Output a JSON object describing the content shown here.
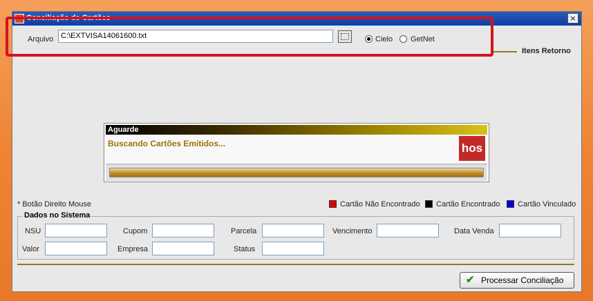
{
  "window": {
    "title": "Conciliação de Cartões",
    "close_label": "×"
  },
  "file": {
    "label": "Arquivo",
    "value": "C:\\EXTVISA14061600.txt",
    "options": [
      "Cielo",
      "GetNet"
    ],
    "selected": "Cielo"
  },
  "section_itens_retorno": "Itens Retorno",
  "progress": {
    "title": "Aguarde",
    "message": "Buscando Cartões Emitidos...",
    "logo_text": "hos",
    "fraction": 1.0
  },
  "hint": "* Botão Direito Mouse",
  "legend": [
    {
      "label": "Cartão Não Encontrado",
      "color": "#e00000"
    },
    {
      "label": "Cartão Encontrado",
      "color": "#000000"
    },
    {
      "label": "Cartão Vinculado",
      "color": "#0000e0"
    }
  ],
  "dados": {
    "title": "Dados no Sistema",
    "fields": {
      "nsu": {
        "label": "NSU",
        "value": ""
      },
      "cupom": {
        "label": "Cupom",
        "value": ""
      },
      "parcela": {
        "label": "Parcela",
        "value": ""
      },
      "vencimento": {
        "label": "Vencimento",
        "value": ""
      },
      "data_venda": {
        "label": "Data Venda",
        "value": ""
      },
      "valor": {
        "label": "Valor",
        "value": ""
      },
      "empresa": {
        "label": "Empresa",
        "value": ""
      },
      "status": {
        "label": "Status",
        "value": ""
      }
    }
  },
  "buttons": {
    "processar": "Processar Conciliação"
  }
}
